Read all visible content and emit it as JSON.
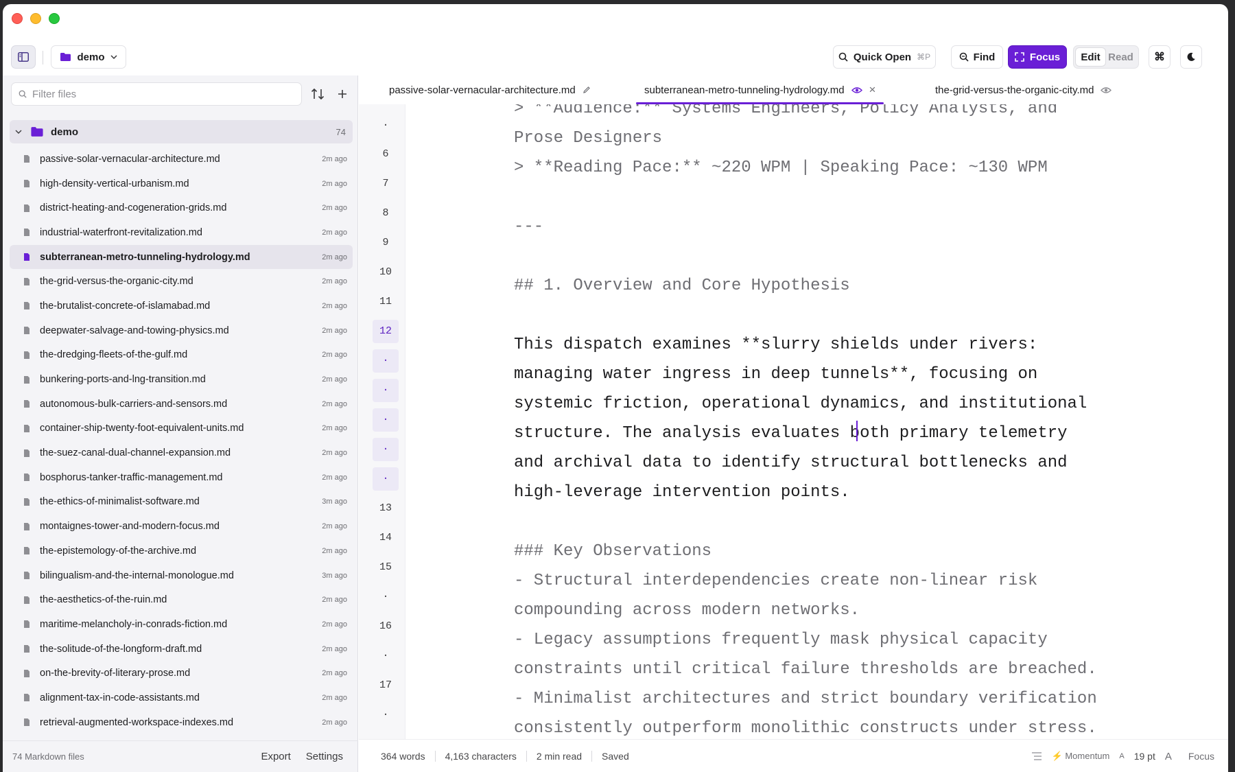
{
  "toolbar": {
    "folder_label": "demo",
    "quick_open_label": "Quick Open",
    "quick_open_shortcut": "⌘P",
    "find_label": "Find",
    "focus_label": "Focus",
    "mode_edit": "Edit",
    "mode_read": "Read",
    "cmd_label": "⌘"
  },
  "sidebar": {
    "filter_placeholder": "Filter files",
    "root_name": "demo",
    "root_count": "74",
    "files": [
      {
        "name": "passive-solar-vernacular-architecture.md",
        "time": "2m ago"
      },
      {
        "name": "high-density-vertical-urbanism.md",
        "time": "2m ago"
      },
      {
        "name": "district-heating-and-cogeneration-grids.md",
        "time": "2m ago"
      },
      {
        "name": "industrial-waterfront-revitalization.md",
        "time": "2m ago"
      },
      {
        "name": "subterranean-metro-tunneling-hydrology.md",
        "time": "2m ago"
      },
      {
        "name": "the-grid-versus-the-organic-city.md",
        "time": "2m ago"
      },
      {
        "name": "the-brutalist-concrete-of-islamabad.md",
        "time": "2m ago"
      },
      {
        "name": "deepwater-salvage-and-towing-physics.md",
        "time": "2m ago"
      },
      {
        "name": "the-dredging-fleets-of-the-gulf.md",
        "time": "2m ago"
      },
      {
        "name": "bunkering-ports-and-lng-transition.md",
        "time": "2m ago"
      },
      {
        "name": "autonomous-bulk-carriers-and-sensors.md",
        "time": "2m ago"
      },
      {
        "name": "container-ship-twenty-foot-equivalent-units.md",
        "time": "2m ago"
      },
      {
        "name": "the-suez-canal-dual-channel-expansion.md",
        "time": "2m ago"
      },
      {
        "name": "bosphorus-tanker-traffic-management.md",
        "time": "2m ago"
      },
      {
        "name": "the-ethics-of-minimalist-software.md",
        "time": "3m ago"
      },
      {
        "name": "montaignes-tower-and-modern-focus.md",
        "time": "2m ago"
      },
      {
        "name": "the-epistemology-of-the-archive.md",
        "time": "2m ago"
      },
      {
        "name": "bilingualism-and-the-internal-monologue.md",
        "time": "3m ago"
      },
      {
        "name": "the-aesthetics-of-the-ruin.md",
        "time": "2m ago"
      },
      {
        "name": "maritime-melancholy-in-conrads-fiction.md",
        "time": "2m ago"
      },
      {
        "name": "the-solitude-of-the-longform-draft.md",
        "time": "2m ago"
      },
      {
        "name": "on-the-brevity-of-literary-prose.md",
        "time": "2m ago"
      },
      {
        "name": "alignment-tax-in-code-assistants.md",
        "time": "2m ago"
      },
      {
        "name": "retrieval-augmented-workspace-indexes.md",
        "time": "2m ago"
      }
    ],
    "footer_count": "74 Markdown files",
    "export_label": "Export",
    "settings_label": "Settings"
  },
  "tabs": [
    {
      "label": "passive-solar-vernacular-architecture.md",
      "icon": "pencil-icon"
    },
    {
      "label": "subterranean-metro-tunneling-hydrology.md",
      "icon": "eye-icon",
      "close": "×"
    },
    {
      "label": "the-grid-versus-the-organic-city.md",
      "icon": "eye-icon"
    }
  ],
  "gutter": {
    "n0": "·",
    "n6": "6",
    "n7": "7",
    "n8": "8",
    "n9": "9",
    "n10": "10",
    "n11": "11",
    "n12": "12",
    "w": "·",
    "n13": "13",
    "n14": "14",
    "n15": "15",
    "n16": "16",
    "n17": "17"
  },
  "document": {
    "l0": "> **Audience:** Systems Engineers, Policy Analysts, and",
    "l1": "Prose Designers",
    "l2": "> **Reading Pace:** ~220 WPM | Speaking Pace: ~130 WPM",
    "l3": "---",
    "l4": "## 1. Overview and Core Hypothesis",
    "l5": "This dispatch examines **slurry shields under rivers:",
    "l6": "managing water ingress in deep tunnels**, focusing on",
    "l7": "systemic friction, operational dynamics, and institutional",
    "l8": "structure. The analysis evaluates both primary telemetry",
    "l9": "and archival data to identify structural bottlenecks and",
    "l10": "high-leverage intervention points.",
    "l11": "### Key Observations",
    "l12": "- Structural interdependencies create non-linear risk",
    "l13": "compounding across modern networks.",
    "l14": "- Legacy assumptions frequently mask physical capacity",
    "l15": "constraints until critical failure thresholds are breached.",
    "l16": "- Minimalist architectures and strict boundary verification",
    "l17": "consistently outperform monolithic constructs under stress."
  },
  "status": {
    "words": "364 words",
    "chars": "4,163 characters",
    "read": "2 min read",
    "saved": "Saved",
    "theme": "Momentum",
    "font_small": "A",
    "font_size": "19 pt",
    "font_large": "A",
    "focus": "Focus"
  },
  "colors": {
    "accent": "#6a1fd6",
    "active_row": "#e6e4ec",
    "sidebar_bg": "#f4f4f7"
  }
}
